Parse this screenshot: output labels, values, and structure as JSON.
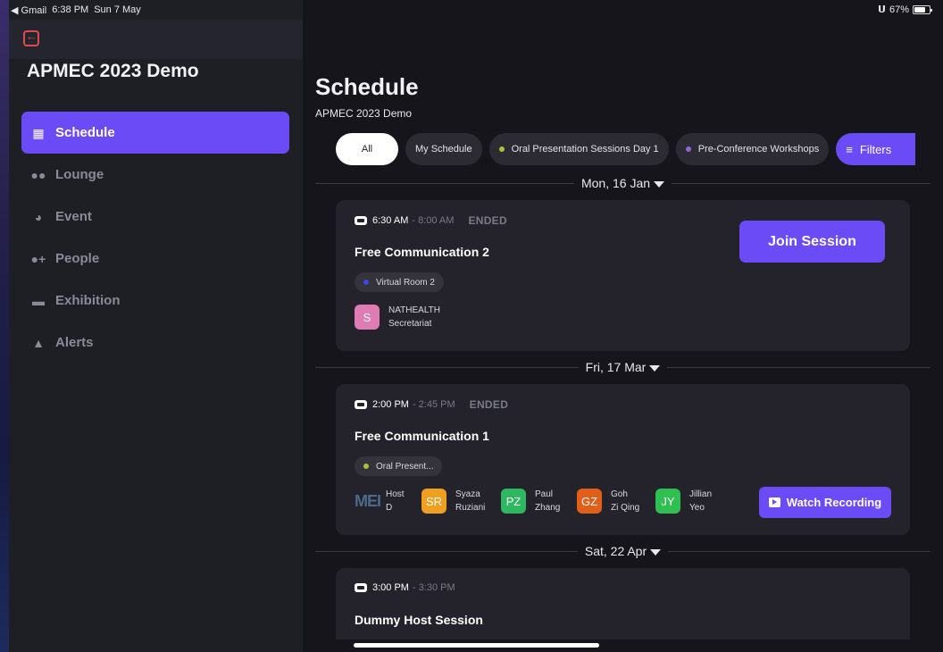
{
  "statusbar": {
    "back_app": "◀ Gmail",
    "time": "6:38 PM",
    "date": "Sun 7 May",
    "battery": "67%"
  },
  "sidebar": {
    "app_title": "APMEC 2023 Demo",
    "items": [
      {
        "label": "Schedule",
        "icon": "calendar-icon"
      },
      {
        "label": "Lounge",
        "icon": "people-group-icon"
      },
      {
        "label": "Event",
        "icon": "speaker-icon"
      },
      {
        "label": "People",
        "icon": "person-add-icon"
      },
      {
        "label": "Exhibition",
        "icon": "booth-icon"
      },
      {
        "label": "Alerts",
        "icon": "bell-icon"
      }
    ]
  },
  "main": {
    "title": "Schedule",
    "subtitle": "APMEC 2023 Demo",
    "chips": [
      {
        "label": "All"
      },
      {
        "label": "My Schedule"
      },
      {
        "label": "Oral Presentation Sessions Day 1",
        "dot": "#a6c33a"
      },
      {
        "label": "Pre-Conference Workshops",
        "dot": "#8a6ad0"
      }
    ],
    "filters_label": "Filters",
    "days": [
      {
        "label": "Mon, 16 Jan",
        "session": {
          "start": "6:30 AM",
          "end": "- 8:00 AM",
          "status": "ENDED",
          "title": "Free Communication 2",
          "room": "Virtual Room 2",
          "room_dot": "#3a4ae0",
          "people": [
            {
              "initials": "S",
              "name1": "NATHEALTH",
              "name2": "Secretariat",
              "color": "#e07cb4"
            }
          ],
          "action": "Join Session"
        }
      },
      {
        "label": "Fri, 17 Mar",
        "session": {
          "start": "2:00 PM",
          "end": "- 2:45 PM",
          "status": "ENDED",
          "title": "Free Communication 1",
          "room": "Oral Present...",
          "room_dot": "#a6c33a",
          "host_logo": "MEI",
          "people": [
            {
              "initials": "",
              "name1": "Host",
              "name2": "D",
              "color": ""
            },
            {
              "initials": "SR",
              "name1": "Syaza",
              "name2": "Ruziani",
              "color": "#f0a020"
            },
            {
              "initials": "PZ",
              "name1": "Paul",
              "name2": "Zhang",
              "color": "#2eb860"
            },
            {
              "initials": "GZ",
              "name1": "Goh",
              "name2": "Zi Qing",
              "color": "#e0601a"
            },
            {
              "initials": "JY",
              "name1": "Jillian",
              "name2": "Yeo",
              "color": "#2ec050"
            }
          ],
          "action": "Watch Recording"
        }
      },
      {
        "label": "Sat, 22 Apr",
        "session": {
          "start": "3:00 PM",
          "end": "- 3:30 PM",
          "title": "Dummy Host Session"
        }
      }
    ]
  }
}
